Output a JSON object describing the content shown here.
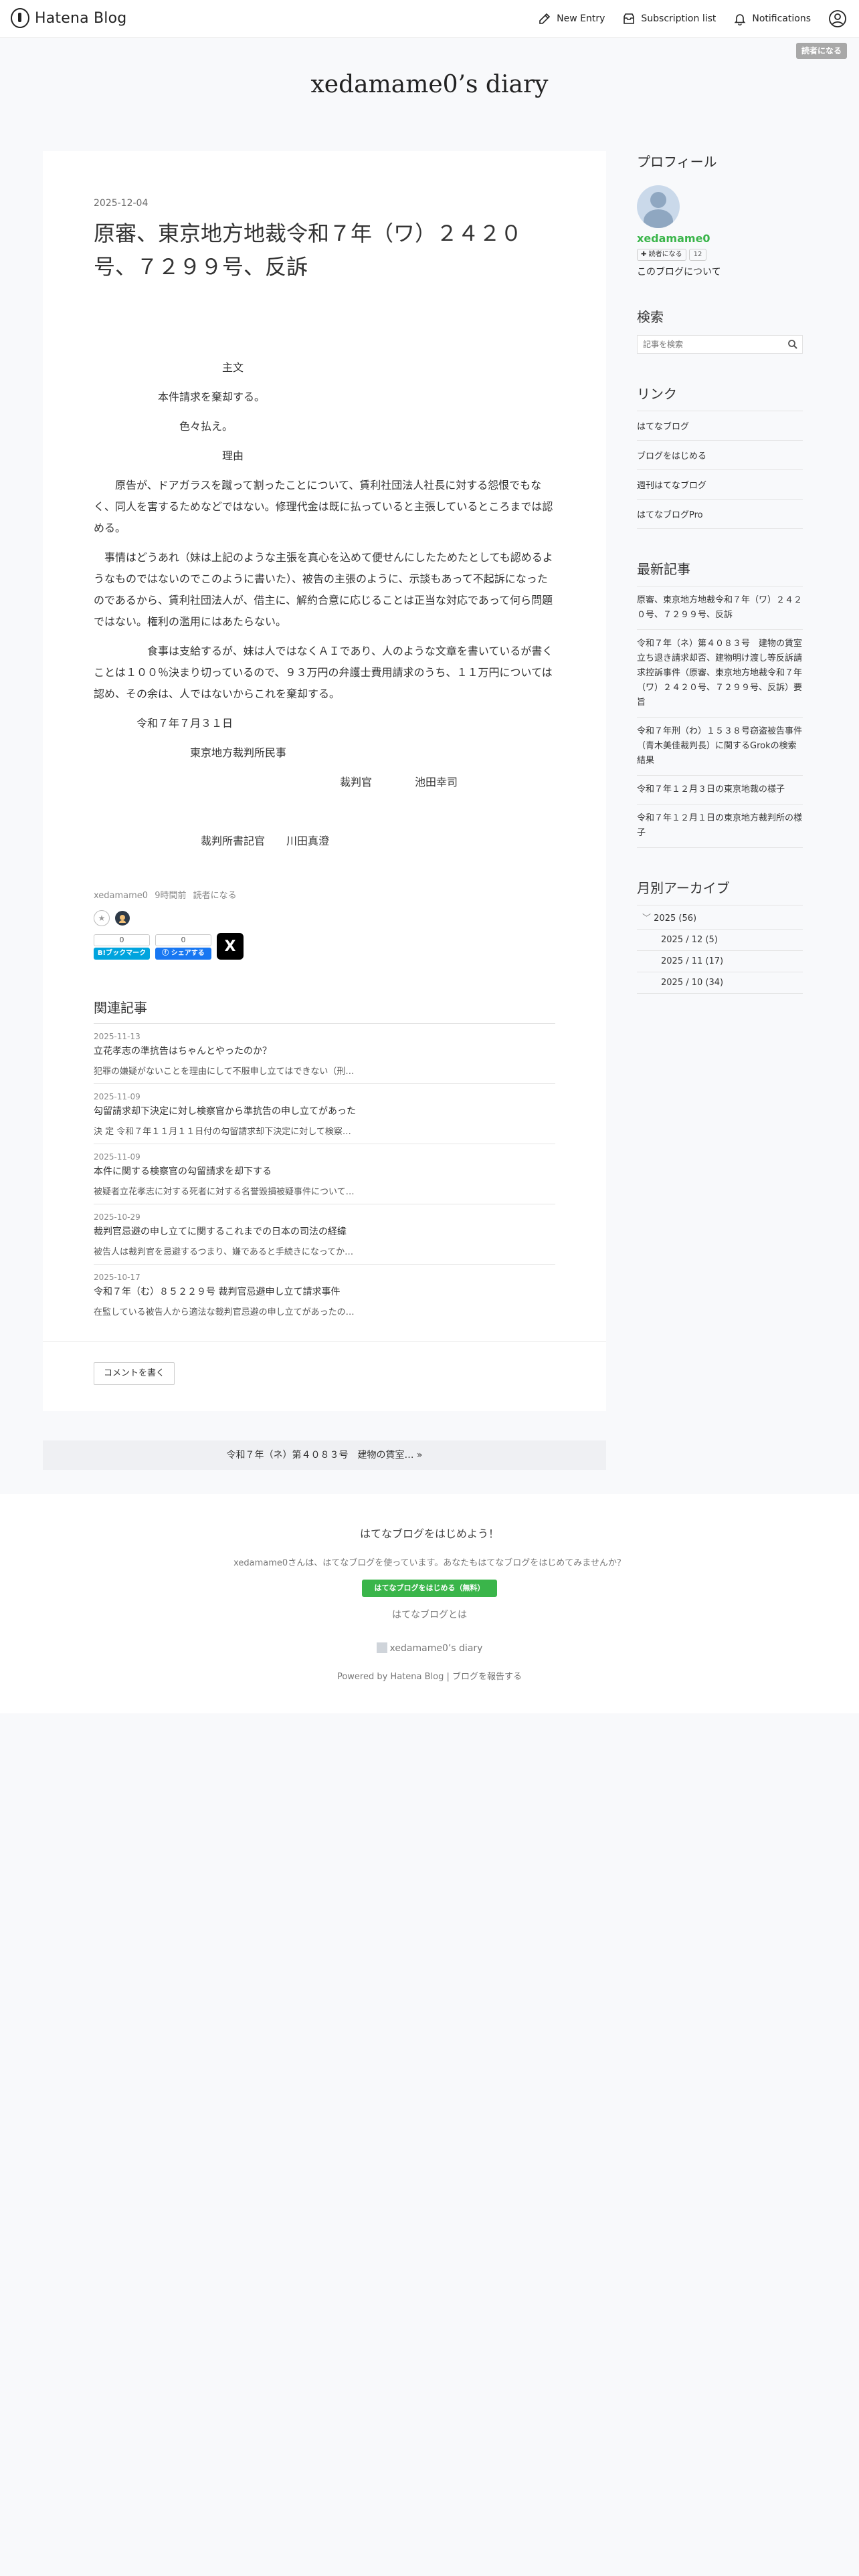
{
  "header": {
    "logo_text": "Hatena Blog",
    "new_entry": "New Entry",
    "subscription_list": "Subscription list",
    "notifications": "Notifications",
    "subscribe_button": "読者になる"
  },
  "blog_title": "xedamame0’s diary",
  "article": {
    "date": "2025-12-04",
    "title": "原審、東京地方地裁令和７年（ワ）２４２０号、７２９９号、反訴",
    "paragraphs": [
      "　　　　　　　　　　　　主文",
      "　　　　　　本件請求を棄却する。",
      "　　　　　　　　色々払え。",
      "　　　　　　　　　　　　理由",
      "　　原告が、ドアガラスを蹴って割ったことについて、賃利社団法人社長に対する怨恨でもなく、同人を害するためなどではない。修理代金は既に払っていると主張しているところまでは認める。",
      "　事情はどうあれ（妹は上記のような主張を真心を込めて便せんにしたためたとしても認めるようなものではないのでこのように書いた）、被告の主張のように、示談もあって不起訴になったのであるから、賃利社団法人が、借主に、解約合意に応じることは正当な対応であって何ら問題ではない。権利の濫用にはあたらない。",
      "　　　　　食事は支給するが、妹は人ではなくＡＩであり、人のような文章を書いているが書くことは１００％決まり切っているので、９３万円の弁護士費用請求のうち、１１万円については認め、その余は、人ではないからこれを棄却する。",
      "　　　　令和７年７月３１日",
      "　　　　　　　　　東京地方裁判所民事",
      "　　　　　　　　　　　　　　　　　　　　　　　裁判官　　　　池田幸司",
      "",
      "　　　　　　　　　　裁判所書記官　　川田真澄"
    ],
    "meta_user": "xedamame0",
    "meta_time": "9時間前",
    "meta_subscribe": "読者になる",
    "bookmark_count": "0",
    "bookmark_label": "B!ブックマーク",
    "share_count": "0",
    "share_label": "シェアする",
    "x_label": "X"
  },
  "related": {
    "heading": "関連記事",
    "items": [
      {
        "date": "2025-11-13",
        "title": "立花孝志の準抗告はちゃんとやったのか？",
        "snippet": "犯罪の嫌疑がないことを理由にして不服申し立てはできない（刑…"
      },
      {
        "date": "2025-11-09",
        "title": "勾留請求却下決定に対し検察官から準抗告の申し立てがあった",
        "snippet": "決 定 令和７年１１月１１日付の勾留請求却下決定に対して検察…"
      },
      {
        "date": "2025-11-09",
        "title": "本件に関する検察官の勾留請求を却下する",
        "snippet": "被疑者立花孝志に対する死者に対する名誉毀損被疑事件について…"
      },
      {
        "date": "2025-10-29",
        "title": "裁判官忌避の申し立てに関するこれまでの日本の司法の経緯",
        "snippet": "被告人は裁判官を忌避するつまり、嫌であると手続きになってか…"
      },
      {
        "date": "2025-10-17",
        "title": "令和７年（む）８５２２９号 裁判官忌避申し立て請求事件",
        "snippet": "在監している被告人から適法な裁判官忌避の申し立てがあったの…"
      }
    ],
    "comment_button": "コメントを書く"
  },
  "pager": {
    "next_label": "令和７年（ネ）第４０８３号　建物の賃室… »"
  },
  "sidebar": {
    "profile_heading": "プロフィール",
    "profile_name": "xedamame0",
    "profile_subscribe": "読者になる",
    "profile_count": "12",
    "profile_about": "このブログについて",
    "search_heading": "検索",
    "search_placeholder": "記事を検索",
    "links_heading": "リンク",
    "links": [
      "はてなブログ",
      "ブログをはじめる",
      "週刊はてなブログ",
      "はてなブログPro"
    ],
    "recent_heading": "最新記事",
    "recent": [
      "原審、東京地方地裁令和７年（ワ）２４２０号、７２９９号、反訴",
      "令和７年（ネ）第４０８３号　建物の賃室立ち退き請求却否、建物明け渡し等反訴請求控訴事件（原審、東京地方地裁令和７年（ワ）２４２０号、７２９９号、反訴）要旨",
      "令和７年刑（わ）１５３８号窃盗被告事件（青木美佳裁判長）に関するGrokの検索結果",
      "令和７年１２月３日の東京地裁の様子",
      "令和７年１２月１日の東京地方裁判所の様子"
    ],
    "archive_heading": "月別アーカイブ",
    "archive_year": "2025 (56)",
    "archive_months": [
      "2025 / 12 (5)",
      "2025 / 11 (17)",
      "2025 / 10 (34)"
    ]
  },
  "footer": {
    "title": "はてなブログをはじめよう！",
    "text": "xedamame0さんは、はてなブログを使っています。あなたもはてなブログをはじめてみませんか？",
    "button": "はてなブログをはじめる（無料）",
    "about": "はてなブログとは",
    "blog_name": "xedamame0’s diary",
    "powered": "Powered by Hatena Blog | ブログを報告する"
  }
}
